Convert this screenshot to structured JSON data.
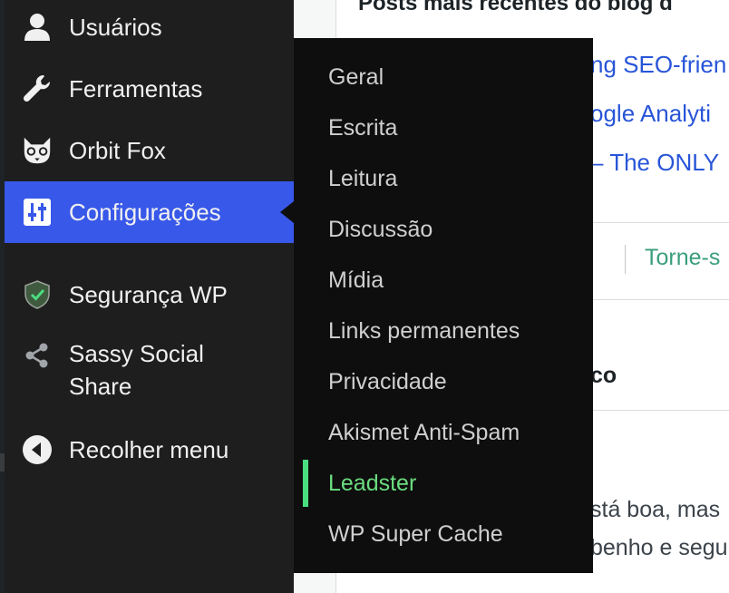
{
  "sidebar": {
    "items": [
      {
        "label": "Usuários",
        "icon": "user-icon"
      },
      {
        "label": "Ferramentas",
        "icon": "wrench-icon"
      },
      {
        "label": "Orbit Fox",
        "icon": "fox-icon"
      },
      {
        "label": "Configurações",
        "icon": "sliders-icon",
        "active": true
      },
      {
        "label": "Segurança WP",
        "icon": "shield-icon"
      },
      {
        "label": "Sassy Social Share",
        "icon": "share-icon"
      },
      {
        "label": "Recolher menu",
        "icon": "collapse-icon"
      }
    ],
    "active_color": "#3858e9"
  },
  "submenu": {
    "items": [
      {
        "label": "Geral"
      },
      {
        "label": "Escrita"
      },
      {
        "label": "Leitura"
      },
      {
        "label": "Discussão"
      },
      {
        "label": "Mídia"
      },
      {
        "label": "Links permanentes"
      },
      {
        "label": "Privacidade"
      },
      {
        "label": "Akismet Anti-Spam"
      },
      {
        "label": "Leadster",
        "active": true
      },
      {
        "label": "WP Super Cache"
      }
    ],
    "active_color": "#4ade80"
  },
  "content": {
    "panel_title": "Posts mais recentes do blog d",
    "links": [
      "ng SEO-frien",
      "ogle Analyti",
      "– The ONLY"
    ],
    "torne": "Torne-s",
    "section_fragment": "co",
    "body_lines": [
      "stá boa, mas",
      "benho e segu"
    ]
  }
}
